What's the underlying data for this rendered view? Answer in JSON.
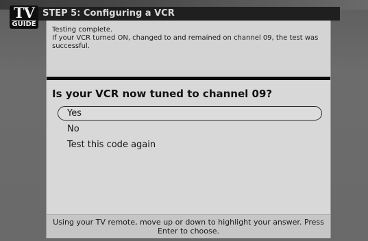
{
  "logo": {
    "top": "TV",
    "bottom": "GUIDE"
  },
  "header": {
    "title": "STEP 5: Configuring a VCR"
  },
  "info": {
    "line1": "Testing complete.",
    "line2": "If your VCR turned ON, changed to and remained on channel 09, the test was successful."
  },
  "question": "Is your VCR now tuned to channel 09?",
  "options": [
    {
      "label": "Yes",
      "selected": true
    },
    {
      "label": "No",
      "selected": false
    },
    {
      "label": "Test this code again",
      "selected": false
    }
  ],
  "footer": "Using your TV remote, move up or down to highlight your answer.  Press Enter to choose."
}
